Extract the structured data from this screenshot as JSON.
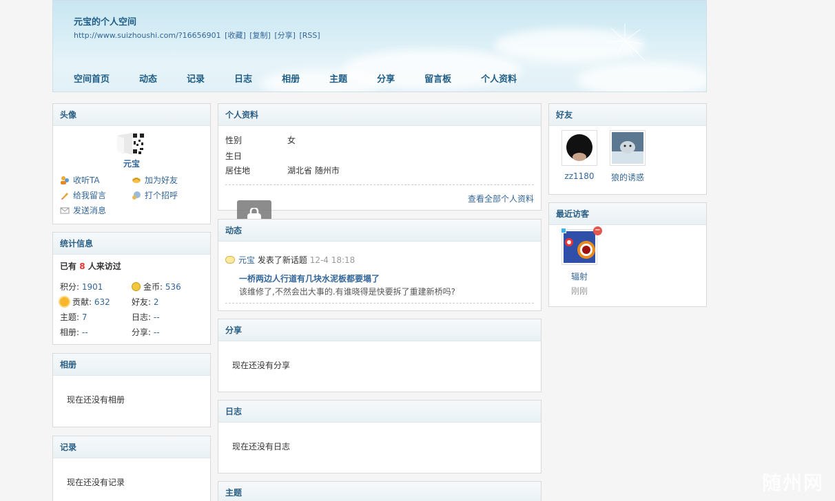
{
  "header": {
    "title": "元宝的个人空间",
    "url": "http://www.suizhoushi.com/?16656901",
    "links": [
      "[收藏]",
      "[复制]",
      "[分享]",
      "[RSS]"
    ],
    "nav": [
      "空间首页",
      "动态",
      "记录",
      "日志",
      "相册",
      "主题",
      "分享",
      "留言板",
      "个人资料"
    ]
  },
  "avatar": {
    "heading": "头像",
    "name": "元宝",
    "actions": [
      "收听TA",
      "加为好友",
      "给我留言",
      "打个招呼",
      "发送消息"
    ]
  },
  "stats": {
    "heading": "统计信息",
    "visit_prefix": "已有",
    "visit_count": "8",
    "visit_suffix": "人来访过",
    "points_label": "积分:",
    "points": "1901",
    "gold_label": "金币:",
    "gold": "536",
    "contrib_label": "贡献:",
    "contrib": "632",
    "friends_label": "好友:",
    "friends": "2",
    "topics_label": "主题:",
    "topics": "7",
    "blog_label": "日志:",
    "blog": "--",
    "album_label": "相册:",
    "album": "--",
    "share_label": "分享:",
    "share": "--"
  },
  "album": {
    "heading": "相册",
    "empty": "现在还没有相册"
  },
  "records": {
    "heading": "记录",
    "empty": "现在还没有记录"
  },
  "profile": {
    "heading": "个人资料",
    "rows": [
      {
        "k": "性别",
        "v": "女"
      },
      {
        "k": "生日",
        "v": ""
      },
      {
        "k": "居住地",
        "v": "湖北省 随州市"
      }
    ],
    "more": "查看全部个人资料"
  },
  "feed": {
    "heading": "动态",
    "user": "元宝",
    "action": "发表了新话题",
    "time": "12-4 18:18",
    "title": "一桥两边人行道有几块水泥板都要塌了",
    "summary": "该维修了,不然会出大事的.有谁晓得是快要拆了重建新桥吗?"
  },
  "share": {
    "heading": "分享",
    "empty": "现在还没有分享"
  },
  "blog": {
    "heading": "日志",
    "empty": "现在还没有日志"
  },
  "topics": {
    "heading": "主题"
  },
  "friends": {
    "heading": "好友",
    "list": [
      "zz1180",
      "狼的诱惑"
    ]
  },
  "visitors": {
    "heading": "最近访客",
    "name": "辐射",
    "time": "刚刚"
  },
  "watermark": "随州网",
  "colors": {
    "link": "#336699",
    "heading": "#2a5f86",
    "highlight": "#e5322d"
  }
}
